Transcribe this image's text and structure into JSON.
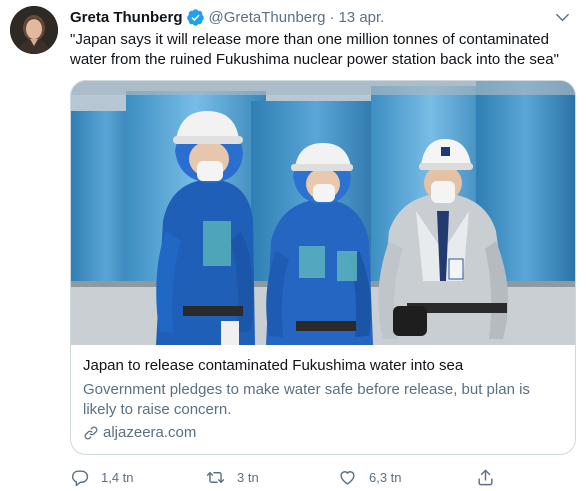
{
  "tweet": {
    "name": "Greta Thunberg",
    "handle": "@GretaThunberg",
    "separator": "·",
    "date": "13 apr.",
    "text": "\"Japan says it will release more than one million tonnes of contaminated water from the ruined Fukushima nuclear power station back into the sea\""
  },
  "card": {
    "title": "Japan to release contaminated Fukushima water into sea",
    "description": "Government pledges to make water safe before release, but plan is likely to raise concern.",
    "domain": "aljazeera.com"
  },
  "actions": {
    "replies": "1,4 tn",
    "retweets": "3 tn",
    "likes": "6,3 tn"
  },
  "icons": {
    "verified": "verified-badge-icon",
    "more": "chevron-down-icon",
    "link": "link-icon",
    "reply": "reply-icon",
    "retweet": "retweet-icon",
    "like": "heart-icon",
    "share": "share-icon"
  },
  "colors": {
    "verified": "#1da1f2",
    "secondary_text": "#5b7083",
    "border": "#cfd9de"
  }
}
